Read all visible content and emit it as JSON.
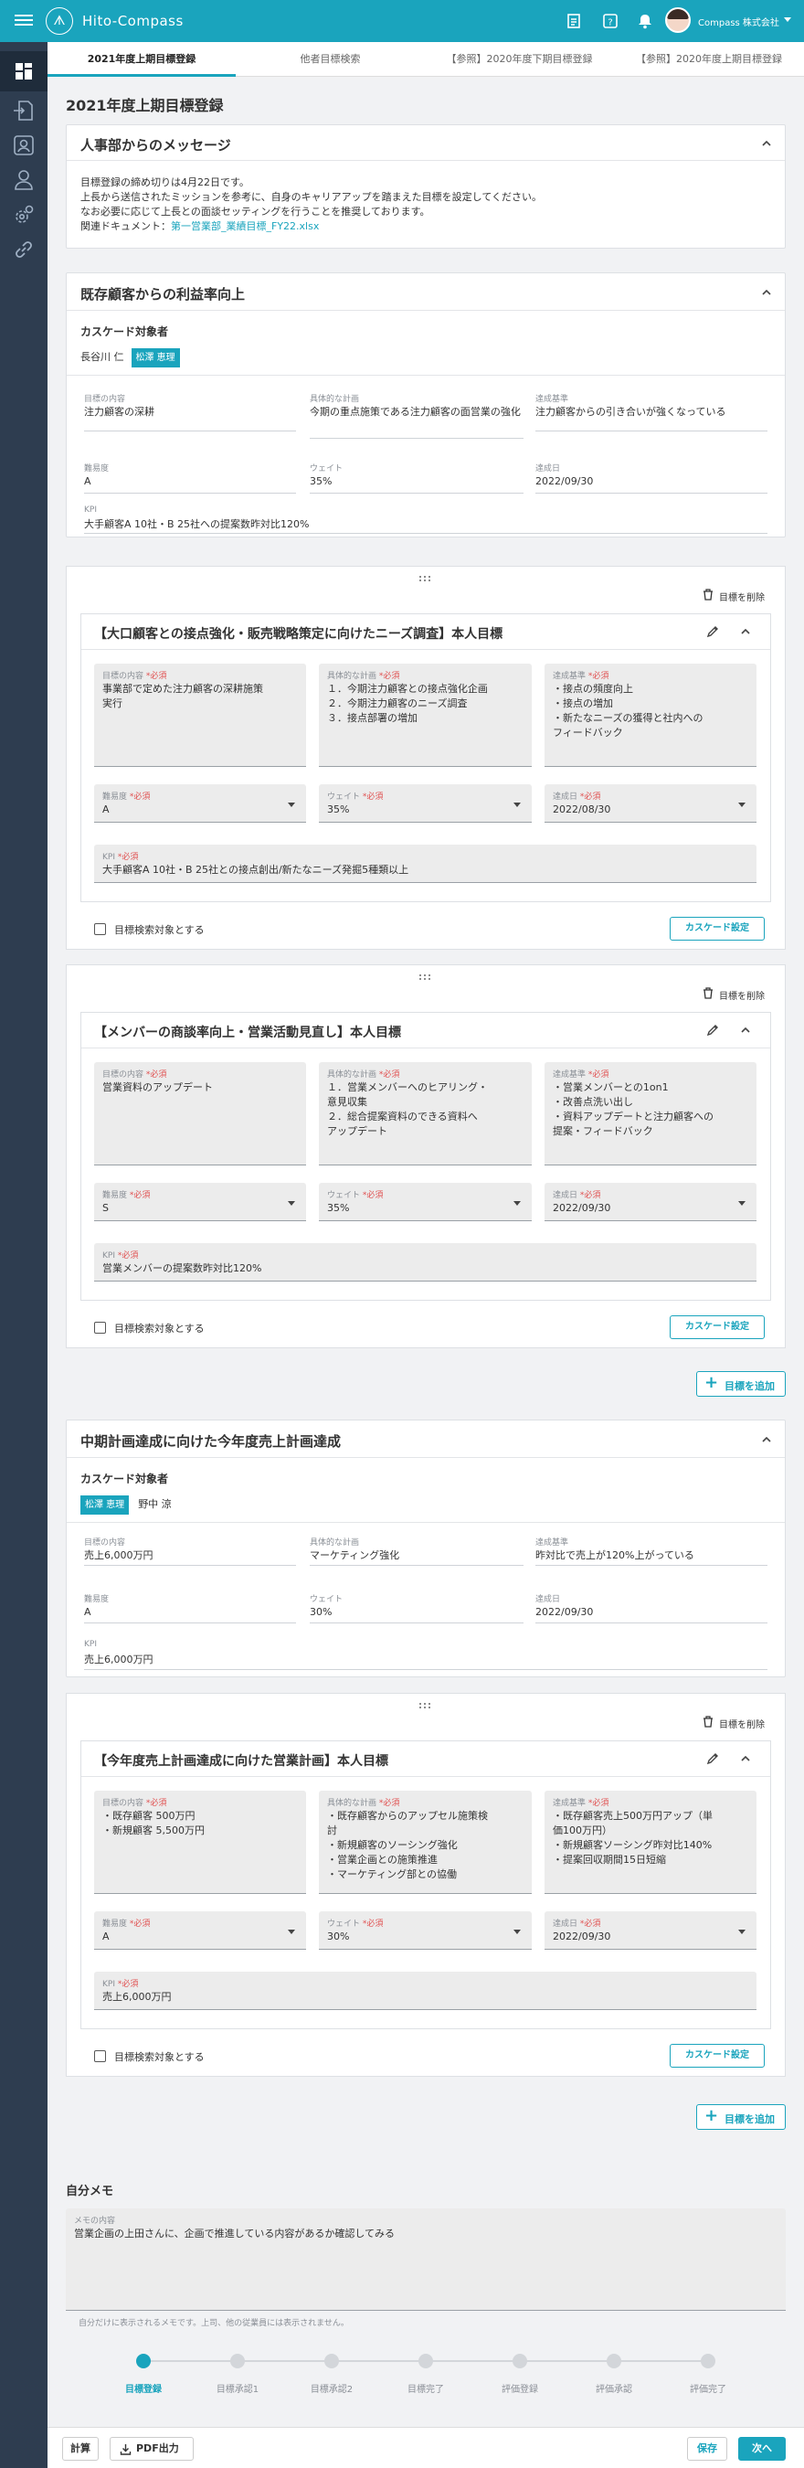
{
  "app": {
    "brand": "Hito-Compass",
    "company": "Compass 株式会社"
  },
  "tabs": [
    "2021年度上期目標登録",
    "他者目標検索",
    "【参照】2020年度下期目標登録",
    "【参照】2020年度上期目標登録"
  ],
  "page_title": "2021年度上期目標登録",
  "hr_message": {
    "title": "人事部からのメッセージ",
    "lines": [
      "目標登録の締め切りは4月22日です。",
      "上長から送信されたミッションを参考に、自身のキャリアアップを踏まえた目標を設定してください。",
      "なお必要に応じて上長との面談セッティングを行うことを推奨しております。"
    ],
    "doc_label": "関連ドキュメント：",
    "doc_link": "第一営業部_業績目標_FY22.xlsx"
  },
  "labels": {
    "cascade_target": "カスケード対象者",
    "content": "目標の内容",
    "plan": "具体的な計画",
    "criteria": "達成基準",
    "difficulty": "難易度",
    "weight": "ウェイト",
    "due": "達成日",
    "kpi": "KPI",
    "required": "*必須",
    "delete": "目標を削除",
    "search_target": "目標検索対象とする",
    "cascade_settings": "カスケード設定",
    "add_goal": "目標を追加"
  },
  "parents": [
    {
      "title": "既存顧客からの利益率向上",
      "cascade_people": [
        "長谷川 仁"
      ],
      "cascade_tag": "松澤 恵理",
      "content": "注力顧客の深耕",
      "plan": "今期の重点施策である注力顧客の面営業の強化",
      "criteria": "注力顧客からの引き合いが強くなっている",
      "difficulty": "A",
      "weight": "35%",
      "due": "2022/09/30",
      "kpi": "大手顧客A 10社・B 25社への提案数昨対比120%"
    },
    {
      "title": "中期計画達成に向けた今年度売上計画達成",
      "cascade_tag": "松澤 恵理",
      "cascade_people": [
        "野中 涼"
      ],
      "content": "売上6,000万円",
      "plan": "マーケティング強化",
      "criteria": "昨対比で売上が120%上がっている",
      "difficulty": "A",
      "weight": "30%",
      "due": "2022/09/30",
      "kpi": "売上6,000万円"
    }
  ],
  "goals": [
    {
      "title": "【大口顧客との接点強化・販売戦略策定に向けたニーズ調査】本人目標",
      "content": "事業部で定めた注力顧客の深耕施策\n実行",
      "plan": "１．今期注力顧客との接点強化企画\n２．今期注力顧客のニーズ調査\n３．接点部署の増加",
      "criteria": "・接点の頻度向上\n・接点の増加\n・新たなニーズの獲得と社内への\nフィードバック",
      "difficulty": "A",
      "weight": "35%",
      "due": "2022/08/30",
      "kpi": "大手顧客A 10社・B 25社との接点創出/新たなニーズ発掘5種類以上"
    },
    {
      "title": "【メンバーの商談率向上・営業活動見直し】本人目標",
      "content": "営業資料のアップデート",
      "plan": "１．営業メンバーへのヒアリング・\n意見収集\n２．総合提案資料のできる資料へ\nアップデート",
      "criteria": "・営業メンバーとの1on1\n・改善点洗い出し\n・資料アップデートと注力顧客への\n提案・フィードバック",
      "difficulty": "S",
      "weight": "35%",
      "due": "2022/09/30",
      "kpi": "営業メンバーの提案数昨対比120%"
    },
    {
      "title": "【今年度売上計画達成に向けた営業計画】本人目標",
      "content": "・既存顧客 500万円\n・新規顧客 5,500万円",
      "plan": "・既存顧客からのアップセル施策検\n討\n・新規顧客のソーシング強化\n・営業企画との施策推進\n・マーケティング部との協働",
      "criteria": "・既存顧客売上500万円アップ（単\n価100万円）\n・新規顧客ソーシング昨対比140%\n・提案回収期間15日短縮",
      "difficulty": "A",
      "weight": "30%",
      "due": "2022/09/30",
      "kpi": "売上6,000万円"
    }
  ],
  "memo": {
    "section_title": "自分メモ",
    "label": "メモの内容",
    "content": "営業企画の上田さんに、企画で推進している内容があるか確認してみる",
    "hint": "自分だけに表示されるメモです。上司、他の従業員には表示されません。"
  },
  "steps": [
    "目標登録",
    "目標承認1",
    "目標承認2",
    "目標完了",
    "評価登録",
    "評価承認",
    "評価完了"
  ],
  "active_step": 0,
  "footer": {
    "calc": "計算",
    "pdf": "PDF出力",
    "save": "保存",
    "next": "次へ"
  },
  "colors": {
    "accent": "#1aa4bd",
    "sidebar": "#2e3d50",
    "required": "#e05050"
  }
}
